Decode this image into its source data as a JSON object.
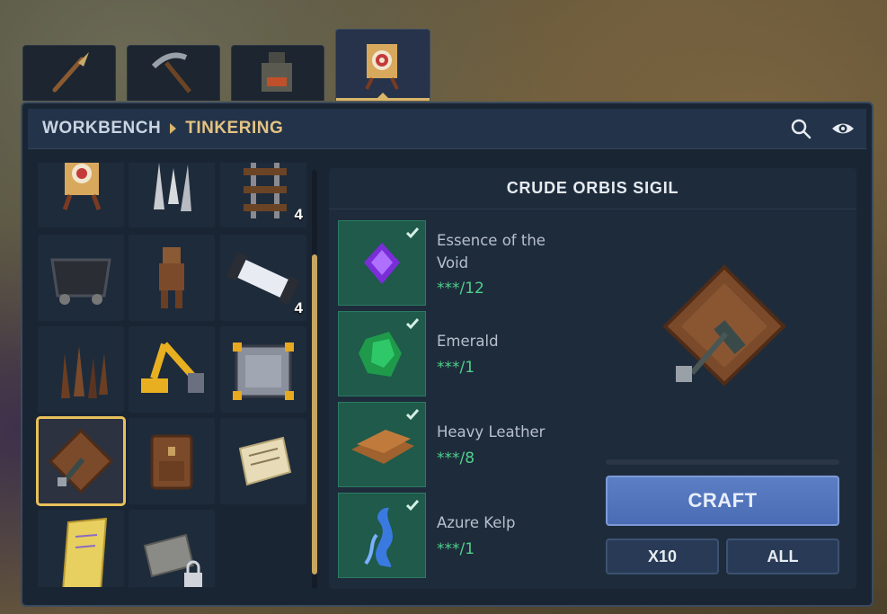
{
  "breadcrumb": {
    "root": "WORKBENCH",
    "current": "TINKERING"
  },
  "tabs": [
    {
      "name": "weapons",
      "icon": "spear-icon"
    },
    {
      "name": "tools",
      "icon": "pickaxe-icon"
    },
    {
      "name": "furnace",
      "icon": "furnace-icon"
    },
    {
      "name": "tinkering",
      "icon": "target-dummy-icon",
      "active": true
    }
  ],
  "header_icons": [
    "search-icon",
    "eye-icon"
  ],
  "grid": {
    "items": [
      {
        "icon": "target-dummy-icon",
        "count": ""
      },
      {
        "icon": "spikes-icon",
        "count": ""
      },
      {
        "icon": "rail-icon",
        "count": "4"
      },
      {
        "icon": "minecart-icon",
        "count": ""
      },
      {
        "icon": "training-dummy-icon",
        "count": ""
      },
      {
        "icon": "light-tube-icon",
        "count": "4"
      },
      {
        "icon": "wooden-stakes-icon",
        "count": ""
      },
      {
        "icon": "mechanical-arm-icon",
        "count": ""
      },
      {
        "icon": "metal-crate-icon",
        "count": ""
      },
      {
        "icon": "orbis-sigil-icon",
        "count": "",
        "selected": true
      },
      {
        "icon": "leather-backpack-icon",
        "count": ""
      },
      {
        "icon": "scroll-icon",
        "count": ""
      },
      {
        "icon": "golden-scroll-icon",
        "count": ""
      },
      {
        "icon": "locked-scroll-icon",
        "count": ""
      }
    ]
  },
  "detail": {
    "title": "CRUDE ORBIS SIGIL",
    "ingredients": [
      {
        "name": "Essence of the Void",
        "qty": "***/12",
        "icon": "void-essence-icon"
      },
      {
        "name": "Emerald",
        "qty": "***/1",
        "icon": "emerald-icon"
      },
      {
        "name": "Heavy Leather",
        "qty": "***/8",
        "icon": "leather-icon"
      },
      {
        "name": "Azure Kelp",
        "qty": "***/1",
        "icon": "azure-kelp-icon"
      }
    ],
    "craft_label": "CRAFT",
    "x10_label": "X10",
    "all_label": "ALL"
  },
  "colors": {
    "accent": "#d9b56a",
    "craft": "#5c7ec4",
    "ingredient_bg": "#1f5a4b",
    "qty": "#4fd08a"
  }
}
